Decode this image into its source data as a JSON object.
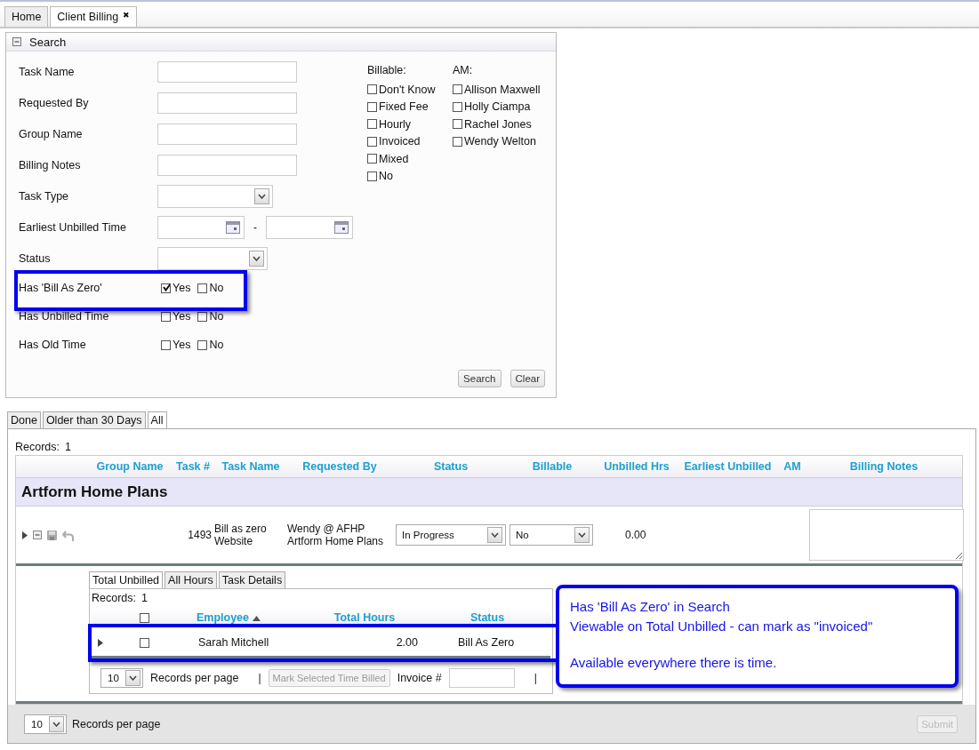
{
  "app_tabs": [
    {
      "label": "Home",
      "selected": false
    },
    {
      "label": "Client Billing",
      "selected": true,
      "close": "✖"
    }
  ],
  "search": {
    "title": "Search",
    "fields": [
      {
        "kind": "text",
        "label": "Task Name"
      },
      {
        "kind": "text",
        "label": "Requested By"
      },
      {
        "kind": "text",
        "label": "Group Name"
      },
      {
        "kind": "text",
        "label": "Billing Notes"
      },
      {
        "kind": "select",
        "label": "Task Type"
      },
      {
        "kind": "daterange",
        "label": "Earliest Unbilled Time",
        "separator": "-"
      },
      {
        "kind": "select",
        "label": "Status"
      },
      {
        "kind": "yesno",
        "label": "Has 'Bill As Zero'",
        "options": [
          {
            "label": "Yes",
            "checked": true
          },
          {
            "label": "No",
            "checked": false
          }
        ]
      },
      {
        "kind": "yesno",
        "label": "Has Unbilled Time",
        "options": [
          {
            "label": "Yes",
            "checked": false
          },
          {
            "label": "No",
            "checked": false
          }
        ]
      },
      {
        "kind": "yesno",
        "label": "Has Old Time",
        "options": [
          {
            "label": "Yes",
            "checked": false
          },
          {
            "label": "No",
            "checked": false
          }
        ]
      }
    ],
    "billable": {
      "label": "Billable:",
      "options": [
        {
          "label": "Don't Know",
          "checked": false
        },
        {
          "label": "Fixed Fee",
          "checked": false
        },
        {
          "label": "Hourly",
          "checked": false
        },
        {
          "label": "Invoiced",
          "checked": false
        },
        {
          "label": "Mixed",
          "checked": false
        },
        {
          "label": "No",
          "checked": false
        }
      ]
    },
    "am": {
      "label": "AM:",
      "options": [
        {
          "label": "Allison Maxwell",
          "checked": false
        },
        {
          "label": "Holly Ciampa",
          "checked": false
        },
        {
          "label": "Rachel Jones",
          "checked": false
        },
        {
          "label": "Wendy Welton",
          "checked": false
        }
      ]
    },
    "buttons": [
      "Search",
      "Clear"
    ]
  },
  "result_tabs": [
    {
      "label": "Done",
      "selected": false
    },
    {
      "label": "Older than 30 Days",
      "selected": false
    },
    {
      "label": "All",
      "selected": true
    }
  ],
  "results": {
    "records_label": "Records:",
    "records_count": "1",
    "columns": [
      "Group Name",
      "Task #",
      "Task Name",
      "Requested By",
      "Status",
      "Billable",
      "Unbilled Hrs",
      "Earliest Unbilled",
      "AM",
      "Billing Notes"
    ],
    "group": "Artform Home Plans",
    "row": {
      "task_no": "1493",
      "task_name": [
        "Bill as zero",
        "Website"
      ],
      "requested_by": [
        "Wendy @ AFHP",
        "Artform Home Plans"
      ],
      "status": "In Progress",
      "billable": "No",
      "unbilled_hrs": "0.00"
    },
    "detail_tabs": [
      {
        "label": "Total Unbilled",
        "selected": true
      },
      {
        "label": "All Hours",
        "selected": false
      },
      {
        "label": "Task Details",
        "selected": false
      }
    ],
    "detail": {
      "records_label": "Records:",
      "records_count": "1",
      "all_checked": false,
      "columns": [
        {
          "label": "Employee",
          "sorted": true
        },
        {
          "label": "Total Hours",
          "sorted": false
        },
        {
          "label": "Status",
          "sorted": false
        }
      ],
      "row": {
        "checked": false,
        "employee": "Sarah Mitchell",
        "total_hours": "2.00",
        "status": "Bill As Zero"
      },
      "pager": [
        {
          "kind": "select",
          "text": "10"
        },
        {
          "kind": "label",
          "text": "Records per page"
        },
        {
          "kind": "sep",
          "text": "|"
        },
        {
          "kind": "button",
          "text": "Mark Selected Time Billed",
          "disabled": true
        },
        {
          "kind": "label",
          "text": "Invoice #"
        },
        {
          "kind": "input"
        },
        {
          "kind": "sep",
          "text": "|"
        }
      ]
    },
    "footer": {
      "per_page": "10",
      "label": "Records per page",
      "submit": "Submit",
      "submit_disabled": true
    }
  },
  "callout": {
    "paragraphs": [
      [
        "Has 'Bill As Zero' in Search",
        "Viewable on Total Unbilled - can mark as \"invoiced\""
      ],
      [
        "Available everywhere there is time."
      ]
    ]
  }
}
